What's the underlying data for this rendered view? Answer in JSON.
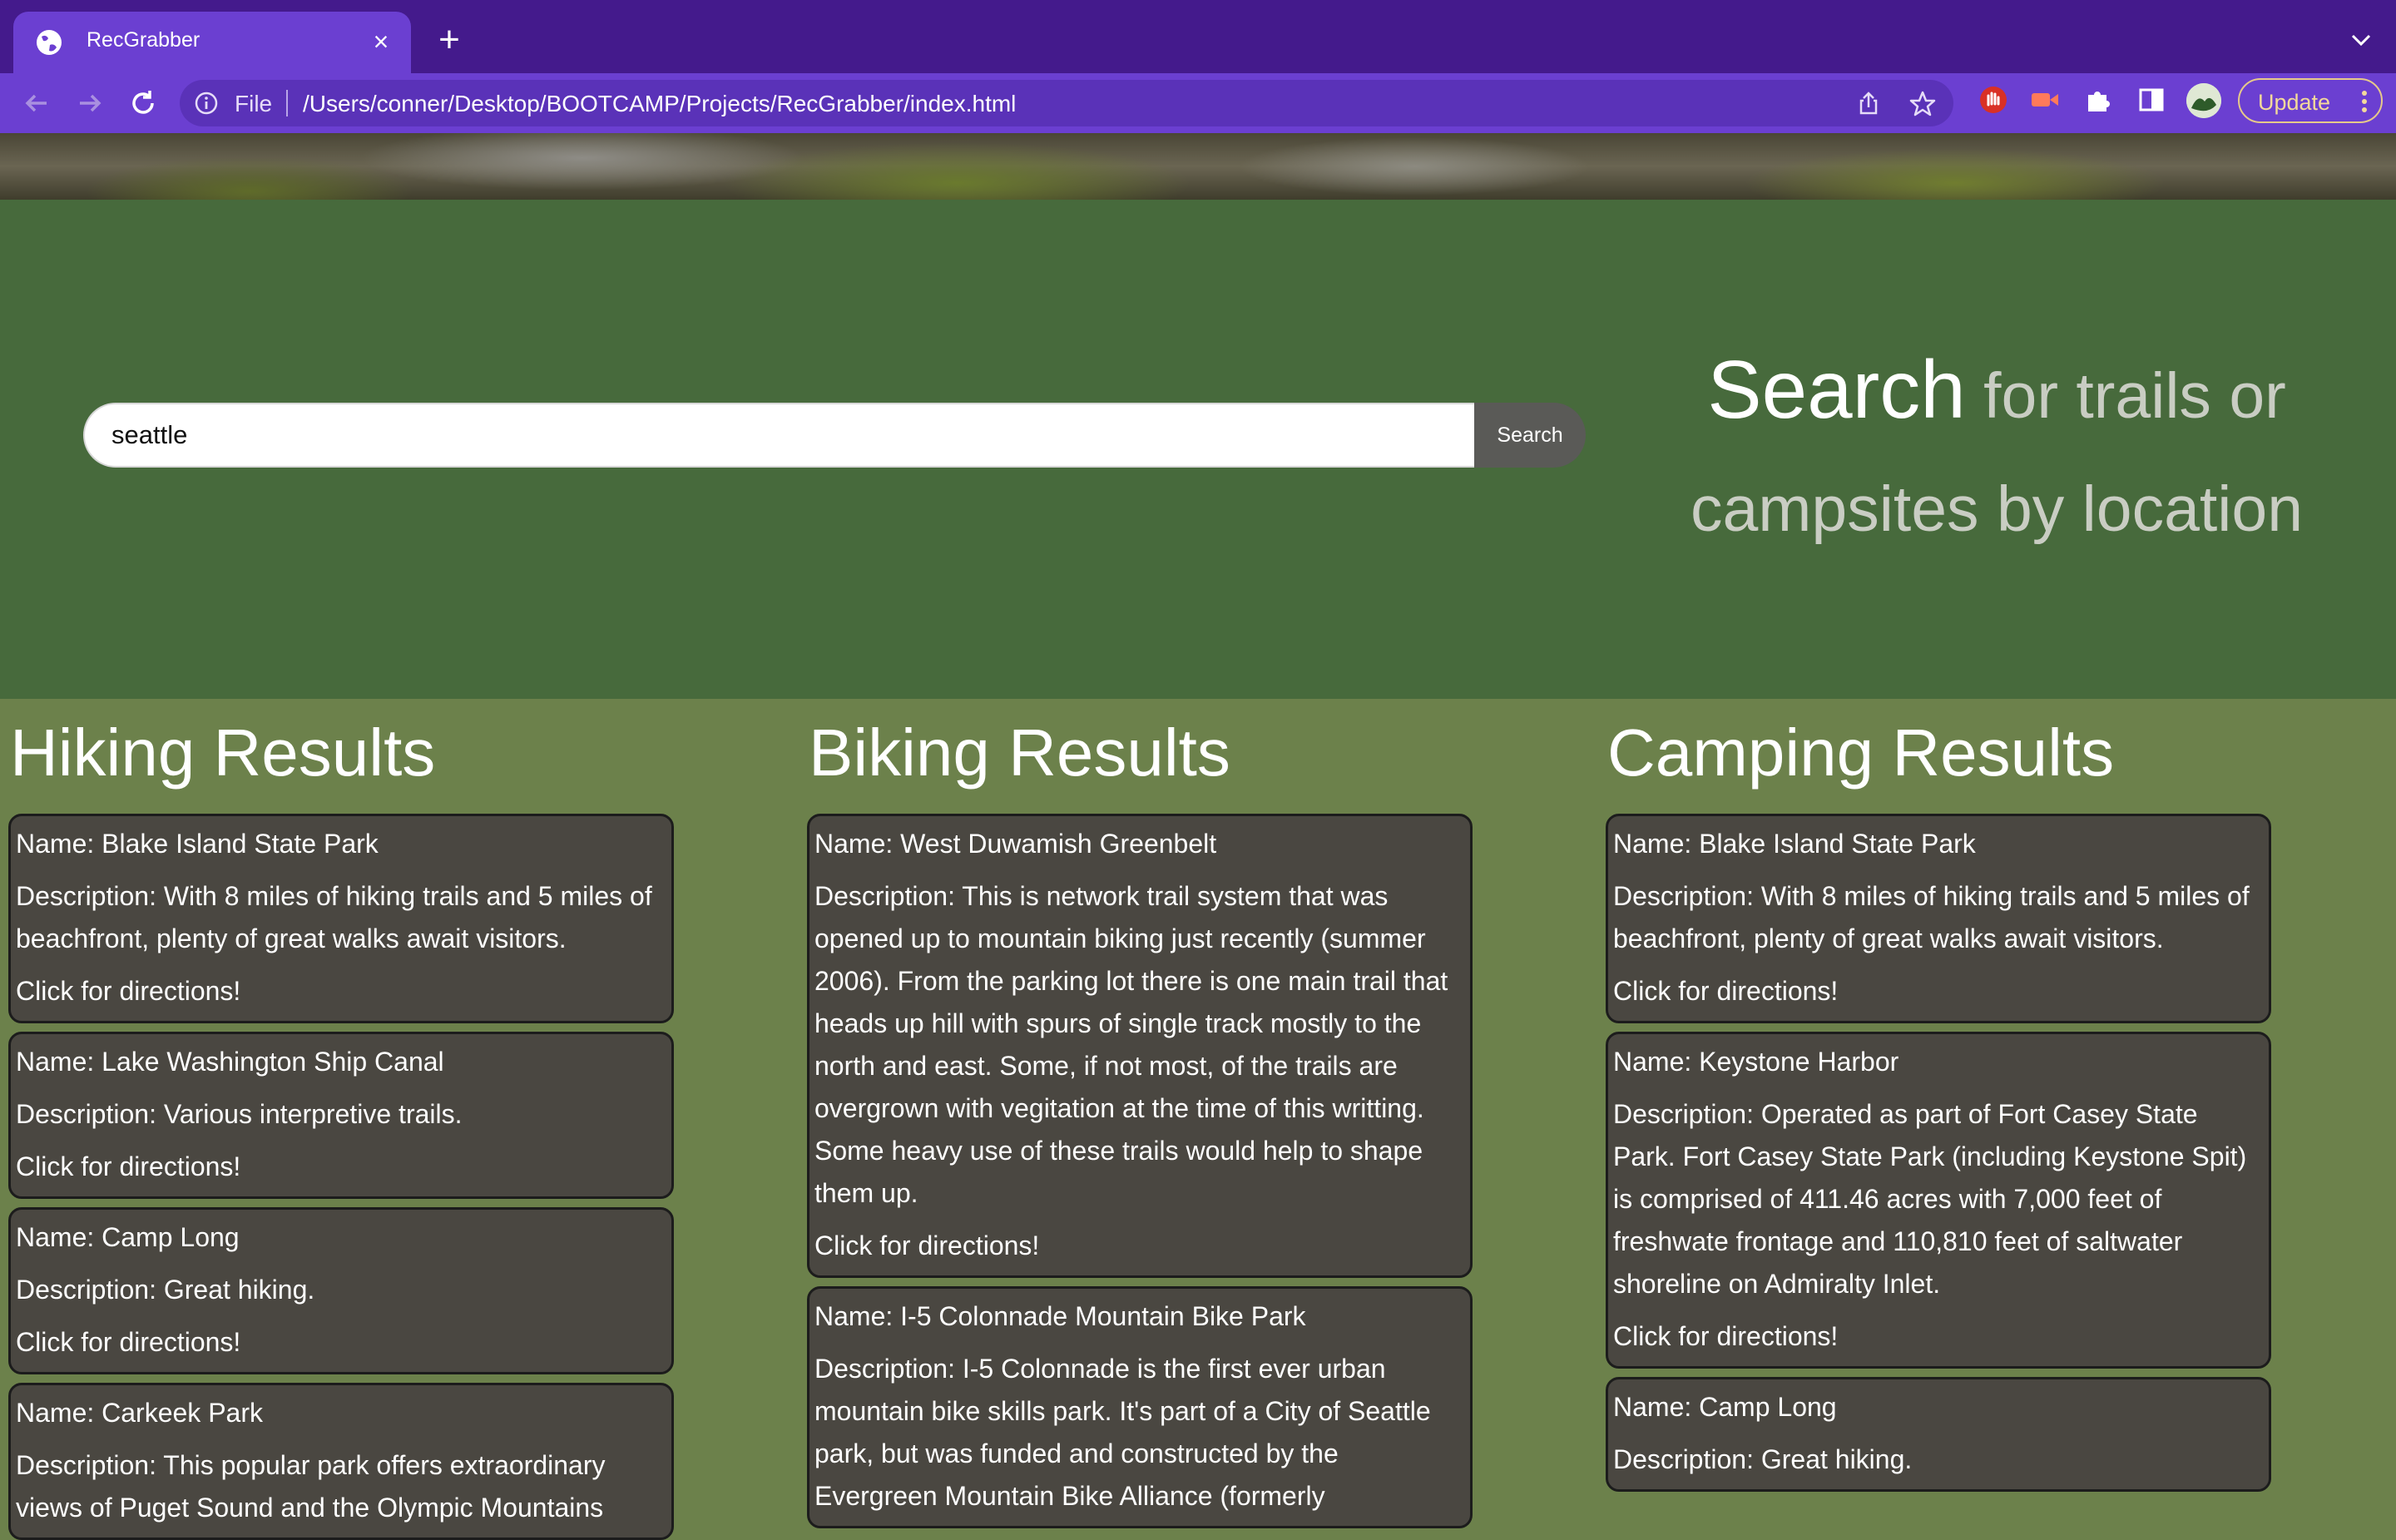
{
  "browser": {
    "tab_title": "RecGrabber",
    "scheme_label": "File",
    "url": "/Users/conner/Desktop/BOOTCAMP/Projects/RecGrabber/index.html",
    "update_label": "Update"
  },
  "search": {
    "value": "seattle",
    "button_label": "Search",
    "tagline_big": "Search",
    "tagline_rest": " for trails or campsites by location"
  },
  "hiking": {
    "heading": "Hiking Results",
    "results": [
      {
        "name": "Name: Blake Island State Park",
        "description": "Description: With 8 miles of hiking trails and 5 miles of beachfront, plenty of great walks await visitors.",
        "link": "Click for directions!"
      },
      {
        "name": "Name: Lake Washington Ship Canal",
        "description": "Description: Various interpretive trails.",
        "link": "Click for directions!"
      },
      {
        "name": "Name: Camp Long",
        "description": "Description: Great hiking.",
        "link": "Click for directions!"
      },
      {
        "name": "Name: Carkeek Park",
        "description": "Description: This popular park offers extraordinary views of Puget Sound and the Olympic Mountains"
      }
    ]
  },
  "biking": {
    "heading": "Biking Results",
    "results": [
      {
        "name": "Name: West Duwamish Greenbelt",
        "description": "Description: This is network trail system that was opened up to mountain biking just recently (summer 2006). From the parking lot there is one main trail that heads up hill with spurs of single track mostly to the north and east. Some, if not most, of the trails are overgrown with vegitation at the time of this writting. Some heavy use of these trails would help to shape them up.",
        "link": "Click for directions!"
      },
      {
        "name": "Name: I-5 Colonnade Mountain Bike Park",
        "description": "Description: I-5 Colonnade is the first ever urban mountain bike skills park. It's part of a City of Seattle park, but was funded and constructed by the Evergreen Mountain Bike Alliance (formerly"
      }
    ]
  },
  "camping": {
    "heading": "Camping Results",
    "results": [
      {
        "name": "Name: Blake Island State Park",
        "description": "Description: With 8 miles of hiking trails and 5 miles of beachfront, plenty of great walks await visitors.",
        "link": "Click for directions!"
      },
      {
        "name": "Name: Keystone Harbor",
        "description": "Description: Operated as part of Fort Casey State Park. Fort Casey State Park (including Keystone Spit) is comprised of 411.46 acres with 7,000 feet of freshwate frontage and 110,810 feet of saltwater shoreline on Admiralty Inlet.",
        "link": "Click for directions!"
      },
      {
        "name": "Name: Camp Long",
        "description": "Description: Great hiking."
      }
    ]
  }
}
